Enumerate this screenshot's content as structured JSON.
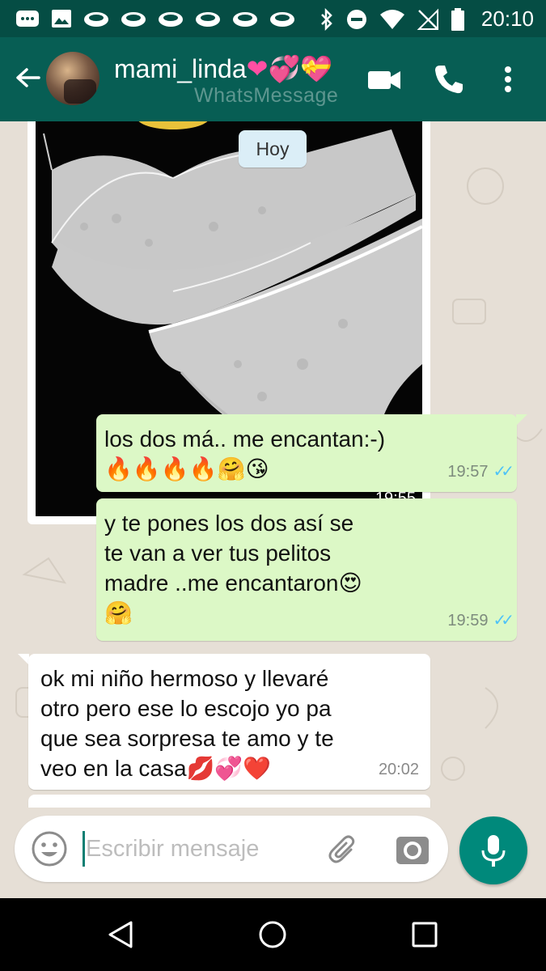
{
  "status_bar": {
    "time": "20:10",
    "left_icons": [
      "messages-icon",
      "image-icon",
      "cloud-icon",
      "cloud-icon",
      "cloud-icon",
      "cloud-icon",
      "cloud-icon",
      "cloud-icon"
    ],
    "right_icons": [
      "bluetooth-icon",
      "do-not-disturb-icon",
      "wifi-icon",
      "no-signal-icon",
      "battery-icon"
    ]
  },
  "header": {
    "contact_name": "mami_linda",
    "contact_name_emojis": "❤💞💝",
    "subtitle": "WhatsMessage"
  },
  "chat": {
    "date_chip": "Hoy",
    "image_message": {
      "time": "19:55"
    },
    "messages": [
      {
        "direction": "out",
        "text": "los dos má.. me encantan:-)\n🔥🔥🔥🔥🤗😘",
        "time": "19:57",
        "status": "read"
      },
      {
        "direction": "out",
        "text": "y te pones los dos así se\nte van a ver tus pelitos\nmadre ..me encantaron😍\n🤗",
        "time": "19:59",
        "status": "read"
      },
      {
        "direction": "in",
        "text": "ok mi niño hermoso y llevaré\notro pero ese lo escojo yo pa\nque sea sorpresa te amo y te\nveo en la casa💋💞❤️",
        "time": "20:02"
      }
    ]
  },
  "composer": {
    "placeholder": "Escribir mensaje"
  },
  "colors": {
    "status_bar": "#054d44",
    "app_bar": "#075e54",
    "outgoing_bubble": "#dcf8c6",
    "incoming_bubble": "#ffffff",
    "mic_button": "#00897b",
    "read_ticks": "#4fc3f7"
  }
}
